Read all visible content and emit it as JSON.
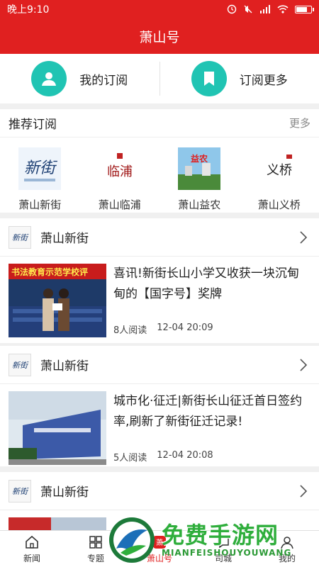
{
  "status_bar": {
    "time": "晚上9:10",
    "signal": "..l",
    "wifi": "wifi"
  },
  "header": {
    "title": "萧山号"
  },
  "subscribe_bar": {
    "my_subs": "我的订阅",
    "more_subs": "订阅更多"
  },
  "recommend": {
    "title": "推荐订阅",
    "more": "更多",
    "items": [
      {
        "name": "萧山新街",
        "logo_text": "新街"
      },
      {
        "name": "萧山临浦",
        "logo_text": "临浦"
      },
      {
        "name": "萧山益农",
        "logo_text": "益农"
      },
      {
        "name": "萧山义桥",
        "logo_text": "义桥"
      }
    ]
  },
  "cards": [
    {
      "source": "萧山新街",
      "logo_text": "新街",
      "title": "喜讯!新街长山小学又收获一块沉甸甸的【国字号】奖牌",
      "reads": "8人阅读",
      "date": "12-04 20:09",
      "thumb_banner": "书法教育示范学校评"
    },
    {
      "source": "萧山新街",
      "logo_text": "新街",
      "title": "城市化·征迁|新街长山征迁首日签约率,刷新了新街征迁记录!",
      "reads": "5人阅读",
      "date": "12-04 20:08",
      "thumb_banner": ""
    },
    {
      "source": "萧山新街",
      "logo_text": "新街",
      "title": "",
      "reads": "",
      "date": "",
      "thumb_banner": ""
    }
  ],
  "tabs": [
    {
      "label": "新闻",
      "icon": "home-icon"
    },
    {
      "label": "专题",
      "icon": "grid-icon"
    },
    {
      "label": "萧山号",
      "icon": "xiaoshan-icon"
    },
    {
      "label": "司城",
      "icon": "city-icon"
    },
    {
      "label": "我的",
      "icon": "user-icon"
    }
  ],
  "watermark": {
    "big": "免费手游网",
    "small": "MIANFEISHOUYOUWANG"
  },
  "colors": {
    "brand_red": "#e02020",
    "teal": "#20c4b3",
    "watermark_green": "#2fae3c"
  }
}
